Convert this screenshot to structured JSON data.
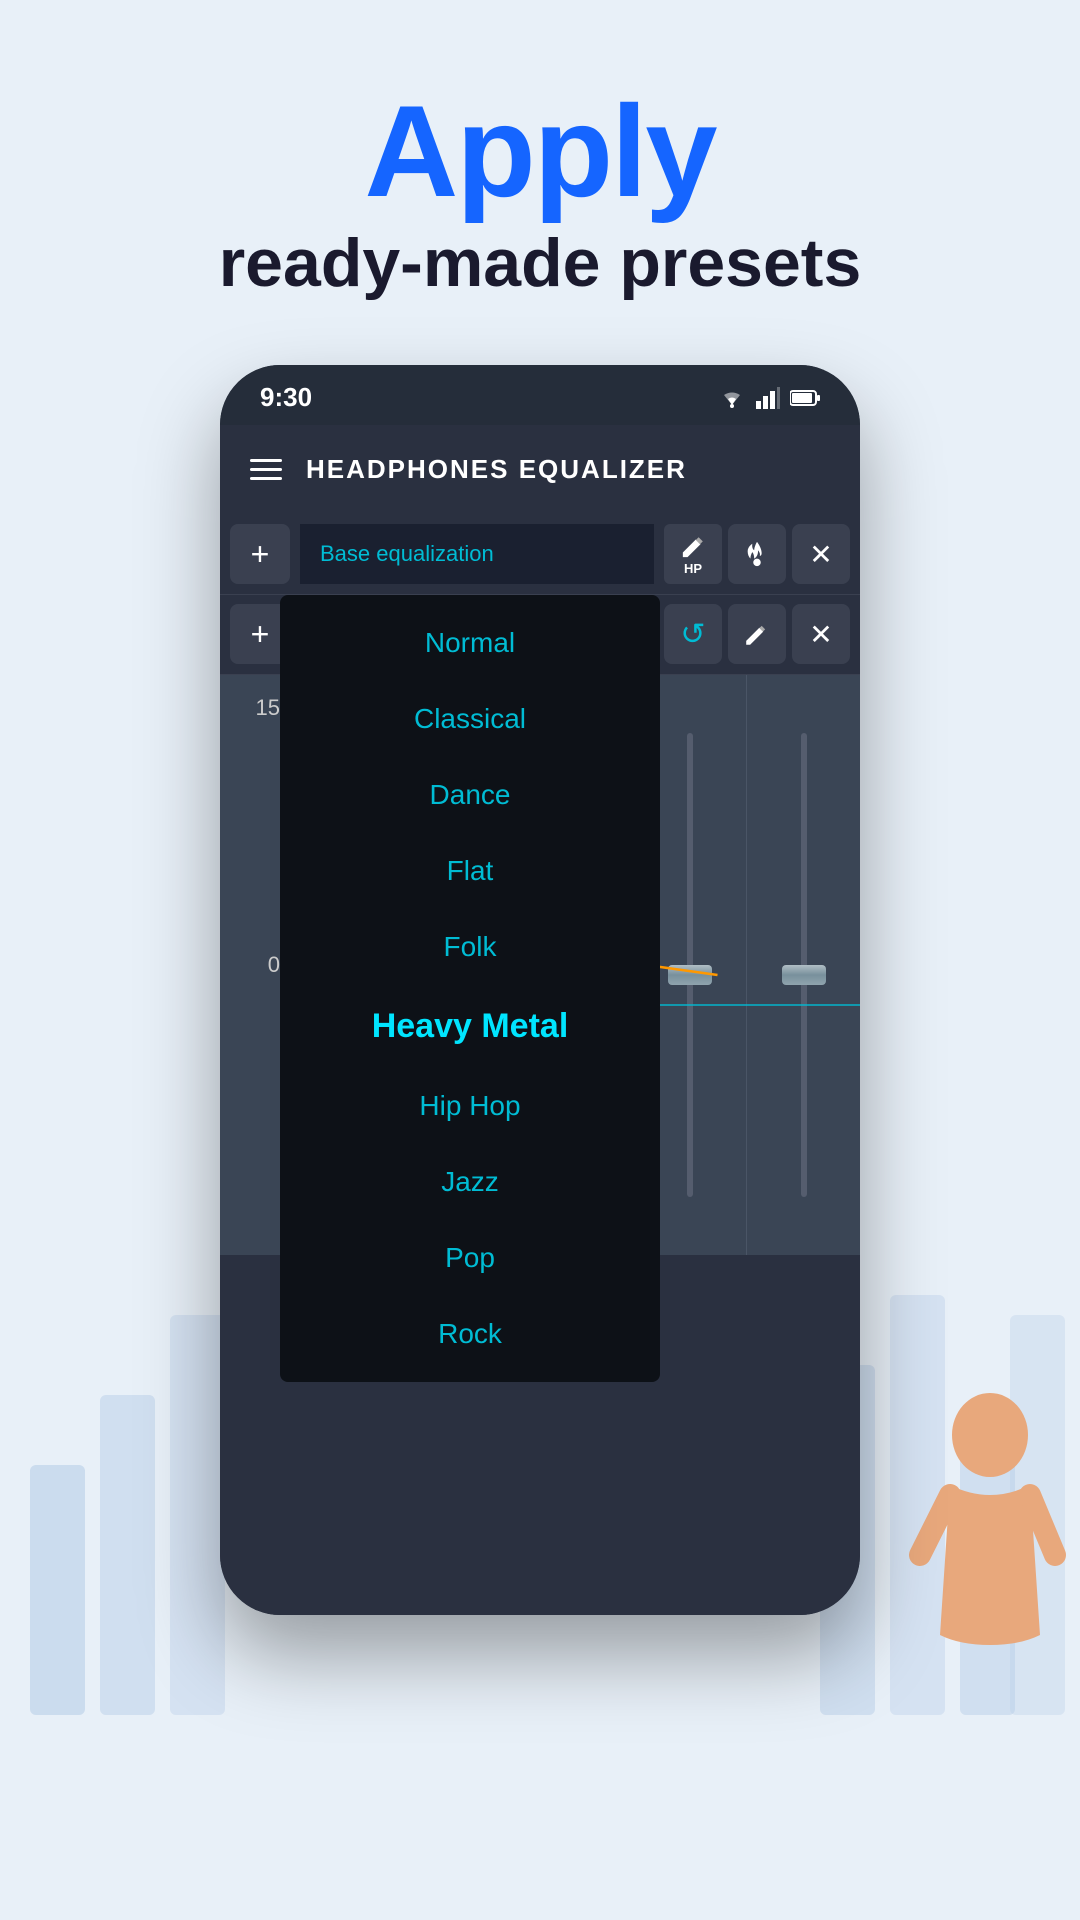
{
  "header": {
    "title": "Apply",
    "subtitle": "ready-made presets"
  },
  "status_bar": {
    "time": "9:30"
  },
  "app_bar": {
    "title": "HEADPHONES EQUALIZER"
  },
  "track1": {
    "label": "Base equalization",
    "btn_add": "+",
    "btn_pencil_hp": "✏",
    "btn_hp_text": "HP",
    "btn_fire": "🔥",
    "btn_close": "✕"
  },
  "track2": {
    "btn_add": "+",
    "btn_undo": "↺",
    "btn_pencil": "✏",
    "btn_close": "✕"
  },
  "presets": {
    "items": [
      {
        "label": "Normal",
        "active": false
      },
      {
        "label": "Classical",
        "active": false
      },
      {
        "label": "Dance",
        "active": false
      },
      {
        "label": "Flat",
        "active": false
      },
      {
        "label": "Folk",
        "active": false
      },
      {
        "label": "Heavy Metal",
        "active": true
      },
      {
        "label": "Hip Hop",
        "active": false
      },
      {
        "label": "Jazz",
        "active": false
      },
      {
        "label": "Pop",
        "active": false
      },
      {
        "label": "Rock",
        "active": false
      }
    ]
  },
  "eq": {
    "scale_top": "15",
    "scale_zero": "0"
  },
  "colors": {
    "accent": "#00bcd4",
    "highlight": "#1565ff",
    "bg_page": "#e8f0f8",
    "bg_phone": "#2a3040",
    "dropdown_bg": "#0d1117"
  }
}
